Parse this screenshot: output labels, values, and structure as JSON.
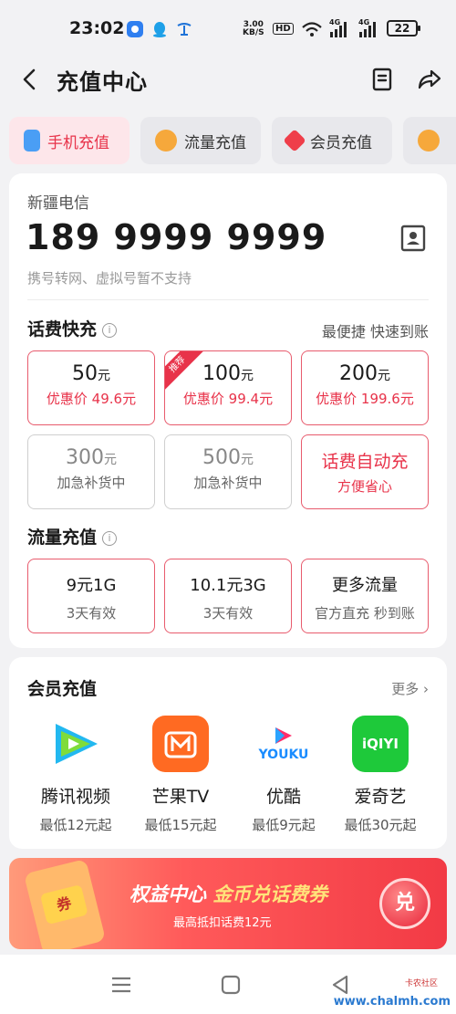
{
  "status": {
    "time": "23:02",
    "speed_value": "3.00",
    "speed_unit": "KB/S",
    "hd": "HD",
    "net1": "4G",
    "net2": "4G",
    "battery": "22"
  },
  "header": {
    "title": "充值中心"
  },
  "tabs": [
    {
      "label": "手机充值",
      "active": true
    },
    {
      "label": "流量充值"
    },
    {
      "label": "会员充值"
    }
  ],
  "account": {
    "carrier": "新疆电信",
    "phone": "189 9999 9999",
    "note": "携号转网、虚拟号暂不支持"
  },
  "fee": {
    "title": "话费快充",
    "tagline": "最便捷 快速到账",
    "unit": "元",
    "options": [
      {
        "amount": "50",
        "sub": "优惠价 49.6元"
      },
      {
        "amount": "100",
        "sub": "优惠价 99.4元",
        "badge": "推荐"
      },
      {
        "amount": "200",
        "sub": "优惠价 199.6元"
      },
      {
        "amount": "300",
        "sub": "加急补货中"
      },
      {
        "amount": "500",
        "sub": "加急补货中"
      },
      {
        "title": "话费自动充",
        "sub": "方便省心"
      }
    ]
  },
  "flow": {
    "title": "流量充值",
    "options": [
      {
        "title": "9元1G",
        "sub": "3天有效"
      },
      {
        "title": "10.1元3G",
        "sub": "3天有效"
      },
      {
        "title": "更多流量",
        "sub": "官方直充 秒到账"
      }
    ]
  },
  "membership": {
    "title": "会员充值",
    "more": "更多",
    "apps": [
      {
        "name": "腾讯视频",
        "price": "最低12元起"
      },
      {
        "name": "芒果TV",
        "price": "最低15元起"
      },
      {
        "name": "优酷",
        "price": "最低9元起",
        "logo_text": "YOUKU"
      },
      {
        "name": "爱奇艺",
        "price": "最低30元起",
        "logo_text": "iQIYI"
      }
    ]
  },
  "banner": {
    "line1_a": "权益中心 ",
    "line1_b": "金币兑话费券",
    "line2": "最高抵扣话费12元",
    "badge": "兑",
    "ticket": "券"
  },
  "watermark": {
    "site": "www.chalmh.com",
    "brand": "卡农社区"
  },
  "colors": {
    "accent": "#e8334a",
    "tab_active_bg": "#fde6ea",
    "card_bg": "#ffffff",
    "page_bg": "#f2f2f4"
  }
}
